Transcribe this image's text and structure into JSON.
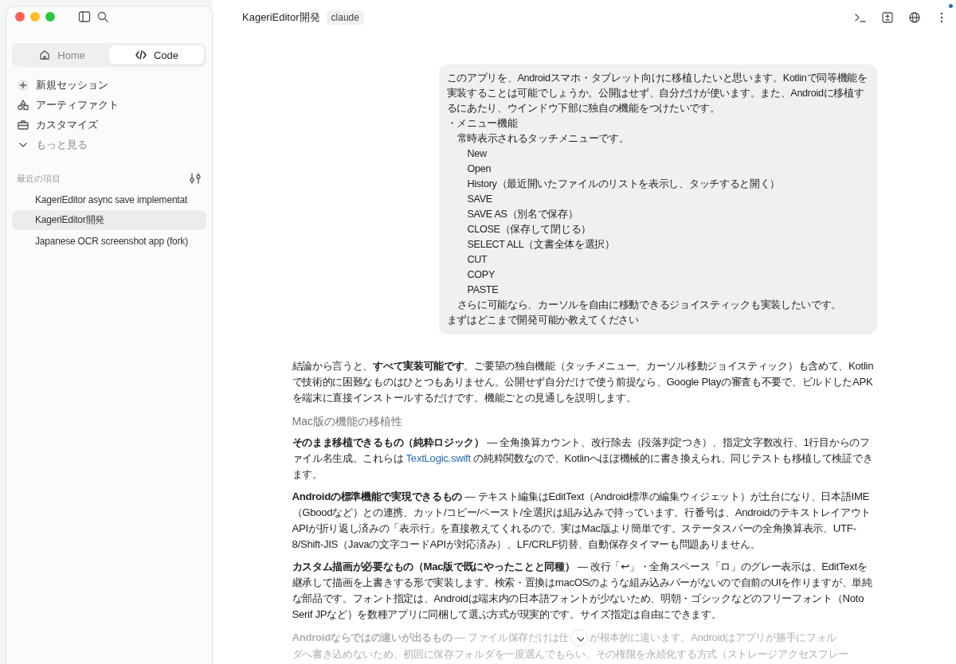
{
  "window": {
    "controls": [
      {
        "kind": "close"
      },
      {
        "kind": "minimize"
      },
      {
        "kind": "zoom"
      }
    ]
  },
  "sidebar": {
    "tabs": [
      {
        "label": "Home",
        "selected": false
      },
      {
        "label": "Code",
        "selected": true
      }
    ],
    "nav": [
      {
        "label": "新規セッション"
      },
      {
        "label": "アーティファクト"
      },
      {
        "label": "カスタマイズ"
      },
      {
        "label": "もっと見る"
      }
    ],
    "recent_heading": "最近の項目",
    "recent": [
      {
        "label": "KageriEditor async save implementat",
        "selected": false
      },
      {
        "label": "KageriEditor開発",
        "selected": true
      },
      {
        "label": "Japanese OCR screenshot app (fork)",
        "selected": false
      }
    ]
  },
  "header": {
    "title": "KageriEditor開発",
    "tag": "claude",
    "notification": true
  },
  "conversation": {
    "user_message": [
      {
        "kind": "text",
        "text": "このアプリを、Androidスマホ・タブレット向けに移植したいと思います。Kotlinで同等機能を実装することは可能でしょうか。公開はせず、自分だけが使います。また、Androidに移植するにあたり、ウインドウ下部に独自の機能をつけたいです。"
      },
      {
        "kind": "text",
        "text": "・メニュー機能"
      },
      {
        "kind": "sub",
        "text": "常時表示されるタッチメニューです。"
      },
      {
        "kind": "item",
        "text": "New"
      },
      {
        "kind": "item",
        "text": "Open"
      },
      {
        "kind": "item",
        "text": "History（最近開いたファイルのリストを表示し、タッチすると開く）"
      },
      {
        "kind": "item",
        "text": "SAVE"
      },
      {
        "kind": "item",
        "text": "SAVE AS（別名で保存）"
      },
      {
        "kind": "item",
        "text": "CLOSE（保存して閉じる）"
      },
      {
        "kind": "item",
        "text": "SELECT ALL（文書全体を選択）"
      },
      {
        "kind": "item",
        "text": "CUT"
      },
      {
        "kind": "item",
        "text": "COPY"
      },
      {
        "kind": "item",
        "text": "PASTE"
      },
      {
        "kind": "sub",
        "text": "さらに可能なら、カーソルを自由に移動できるジョイスティックも実装したいです。"
      },
      {
        "kind": "text",
        "text": "まずはどこまで開発可能か教えてください"
      }
    ],
    "reply": [
      {
        "kind": "paragraph",
        "parts": [
          {
            "text": "結論から言うと、**すべて実装可能です**。ご要望の独自機能（タッチメニュー、カーソル移動ジョイスティック）も含めて、Kotlinで技術的に困難なものはひとつもありません。公開せず自分だけで使う前提なら、Google Playの審査も不要で、ビルドしたAPKを端末に直接インストールするだけです。機能ごとの見通しを説明します。"
          }
        ]
      },
      {
        "kind": "heading",
        "parts": [
          {
            "text": "Mac版の機能の移植性"
          }
        ]
      },
      {
        "kind": "paragraph",
        "parts": [
          {
            "text": "**そのまま移植できるもの（純粋ロジック）** — 全角換算カウント、改行除去（段落判定つき）、指定文字数改行、1行目からのファイル名生成。これらは "
          },
          {
            "text": "TextLogic.swift",
            "link": true
          },
          {
            "text": " の純粋関数なので、Kotlinへほぼ機械的に書き換えられ、同じテストも移植して検証できます。"
          }
        ]
      },
      {
        "kind": "paragraph",
        "parts": [
          {
            "text": "**Androidの標準機能で実現できるもの** — テキスト編集はEditText（Android標準の編集ウィジェット）が土台になり、日本語IME（Gboodなど）との連携、カット/コピー/ペースト/全選択は組み込みで持っています。行番号は、AndroidのテキストレイアウトAPIが折り返し済みの「表示行」を直接教えてくれるので、実はMac版より簡単です。ステータスバーの全角換算表示、UTF-8/Shift-JIS（Javaの文字コードAPIが対応済み）、LF/CRLF切替、自動保存タイマーも問題ありません。"
          }
        ]
      },
      {
        "kind": "paragraph",
        "parts": [
          {
            "text": "**カスタム描画が必要なもの（Mac版で既にやったことと同種）** — 改行「↩」・全角スペース「ロ」のグレー表示は、EditTextを継承して描画を上書きする形で実装します。検索・置換はmacOSのような組み込みバーがないので自前のUIを作りますが、単純な部品です。フォント指定は、Androidは端末内の日本語フォントが少ないため、明朝・ゴシックなどのフリーフォント（Noto Serif JPなど）を数種アプリに同梱して選ぶ方式が現実的です。サイズ指定は自由にできます。"
          }
        ]
      },
      {
        "kind": "faded",
        "parts": [
          {
            "text": "**Androidならではの違いが出るもの** — ファイル保存だけは仕"
          },
          {
            "text": "が根本的に違います。Androidはアプリが勝手にフォル"
          }
        ]
      },
      {
        "kind": "faded",
        "parts": [
          {
            "text": "ダへ書き込めないため、初回に保存フォルダを一度選んでもらい、その権限を永続化する方式（ストレージアクセスフレー"
          }
        ]
      }
    ]
  }
}
